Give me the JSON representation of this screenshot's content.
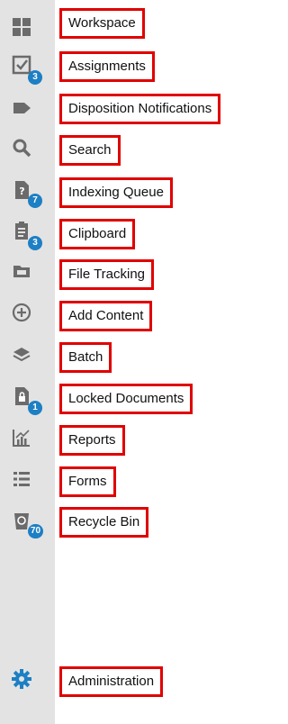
{
  "nav": {
    "items": [
      {
        "label": "Workspace",
        "icon": "grid-icon"
      },
      {
        "label": "Assignments",
        "icon": "checkbox-icon",
        "badge": "3"
      },
      {
        "label": "Disposition Notifications",
        "icon": "tag-icon"
      },
      {
        "label": "Search",
        "icon": "search-icon"
      },
      {
        "label": "Indexing Queue",
        "icon": "document-question-icon",
        "badge": "7"
      },
      {
        "label": "Clipboard",
        "icon": "clipboard-icon",
        "badge": "3"
      },
      {
        "label": "File Tracking",
        "icon": "folder-icon"
      },
      {
        "label": "Add Content",
        "icon": "plus-circle-icon"
      },
      {
        "label": "Batch",
        "icon": "layers-icon"
      },
      {
        "label": "Locked Documents",
        "icon": "document-lock-icon",
        "badge": "1"
      },
      {
        "label": "Reports",
        "icon": "chart-icon"
      },
      {
        "label": "Forms",
        "icon": "list-icon"
      },
      {
        "label": "Recycle Bin",
        "icon": "recycle-icon",
        "badge": "70"
      }
    ],
    "admin": {
      "label": "Administration",
      "icon": "gear-icon"
    }
  },
  "colors": {
    "rail_bg": "#e3e3e3",
    "icon": "#6b6b6b",
    "badge": "#1d7fc4",
    "highlight_border": "#e00000",
    "admin_icon": "#1d7fc4"
  }
}
